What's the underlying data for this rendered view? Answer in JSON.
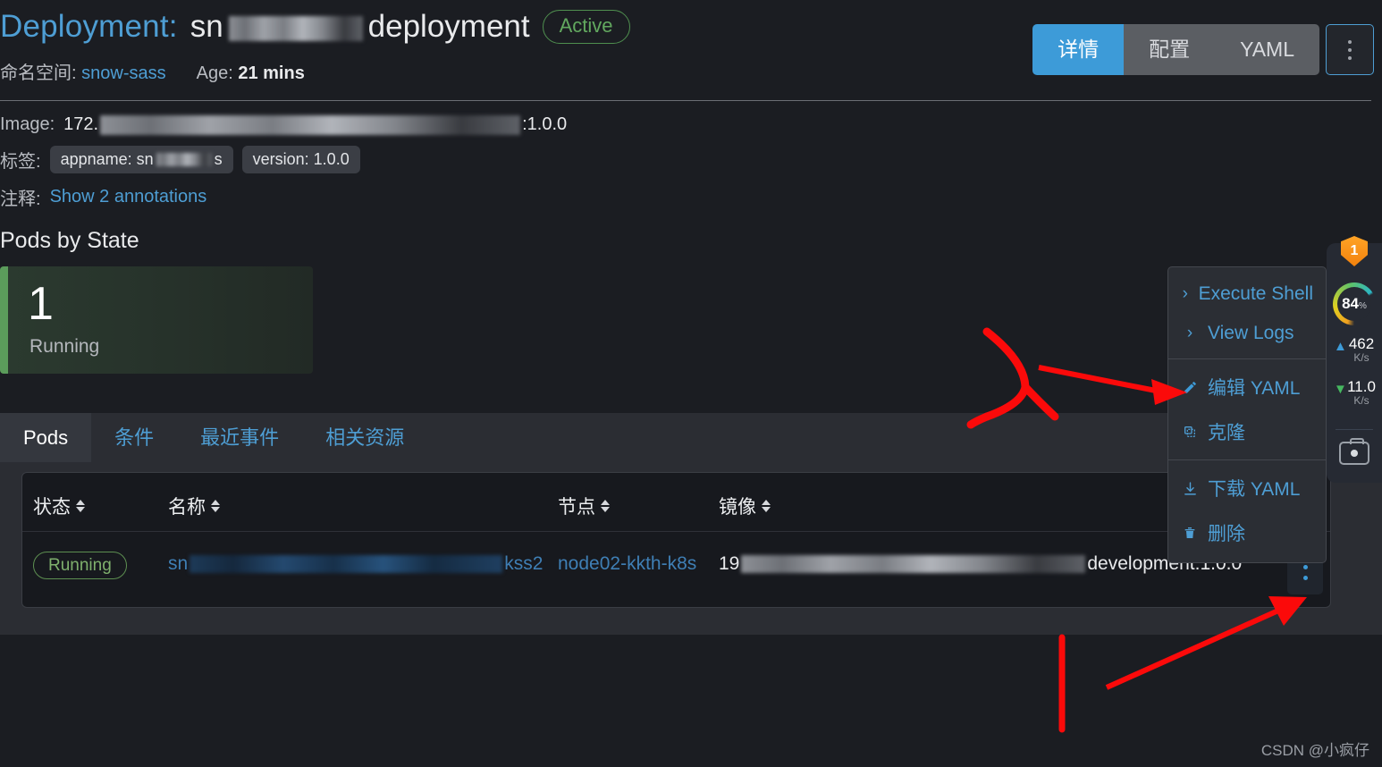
{
  "header": {
    "title_kind": "Deployment:",
    "title_name_prefix": "sn",
    "title_name_suffix": "deployment",
    "status_badge": "Active",
    "namespace_label": "命名空间:",
    "namespace_value": "snow-sass",
    "age_label": "Age:",
    "age_value": "21 mins",
    "tabs": [
      {
        "label": "详情",
        "active": true
      },
      {
        "label": "配置",
        "active": false
      },
      {
        "label": "YAML",
        "active": false
      }
    ],
    "kebab_icon": "vertical-dots-icon"
  },
  "meta": {
    "image_label": "Image:",
    "image_prefix": "172.",
    "image_suffix": ":1.0.0",
    "labels_label": "标签:",
    "chips": [
      {
        "prefix": "appname: sn",
        "suffix": "s"
      },
      {
        "text": "version: 1.0.0"
      }
    ],
    "annotations_label": "注释:",
    "annotations_link": "Show 2 annotations"
  },
  "pods_by_state": {
    "section_title": "Pods by State",
    "count": "1",
    "state_label": "Running",
    "accent_color": "#5b9c5b"
  },
  "sub_tabs": [
    {
      "label": "Pods",
      "active": true
    },
    {
      "label": "条件",
      "active": false
    },
    {
      "label": "最近事件",
      "active": false
    },
    {
      "label": "相关资源",
      "active": false
    }
  ],
  "table": {
    "columns": [
      {
        "label": "状态",
        "sortable": true
      },
      {
        "label": "名称",
        "sortable": true
      },
      {
        "label": "节点",
        "sortable": true
      },
      {
        "label": "镜像",
        "sortable": true
      }
    ],
    "rows": [
      {
        "status": "Running",
        "name_prefix": "sn",
        "name_suffix": "kss2",
        "node": "node02-kkth-k8s",
        "image_prefix": "19",
        "image_suffix": "development:1.0.0",
        "kebab_icon": "vertical-dots-icon"
      }
    ]
  },
  "context_menu": {
    "items": [
      {
        "icon": "chevron-right-icon",
        "label": "Execute Shell"
      },
      {
        "icon": "chevron-right-icon",
        "label": "View Logs"
      },
      {
        "separator_before": true,
        "icon": "pencil-icon",
        "label": "编辑 YAML"
      },
      {
        "icon": "copy-icon",
        "label": "克隆"
      },
      {
        "separator_before": true,
        "icon": "download-icon",
        "label": "下载 YAML"
      },
      {
        "icon": "trash-icon",
        "label": "删除"
      }
    ]
  },
  "widget": {
    "shield_badge": "1",
    "gauge_value": "84",
    "gauge_unit": "%",
    "upload_value": "462",
    "upload_unit": "K/s",
    "download_value": "11.0",
    "download_unit": "K/s",
    "camera_icon": "camera-icon"
  },
  "watermark": "CSDN @小疯仔",
  "colors": {
    "page_bg": "#1b1d22",
    "panel_bg": "#2b2d33",
    "accent_blue": "#4e9ed4",
    "tab_active_blue": "#3d9bd8",
    "status_green": "#62a85f",
    "annotation_red": "#fb0a0a"
  }
}
